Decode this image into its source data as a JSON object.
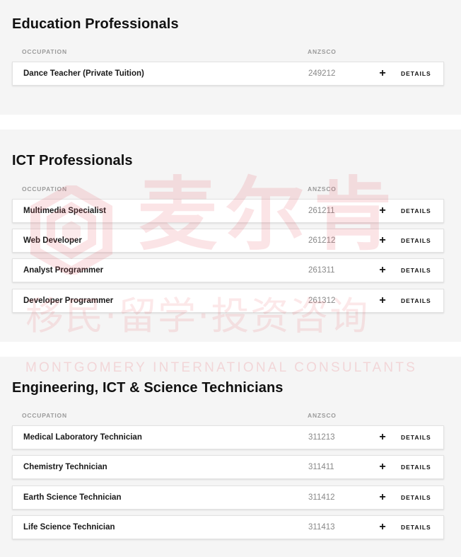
{
  "columns": {
    "occupation": "OCCUPATION",
    "anzsco": "ANZSCO"
  },
  "details_label": "DETAILS",
  "sections": [
    {
      "title": "Education Professionals",
      "rows": [
        {
          "occupation": "Dance Teacher (Private Tuition)",
          "anzsco": "249212"
        }
      ]
    },
    {
      "title": "ICT Professionals",
      "rows": [
        {
          "occupation": "Multimedia Specialist",
          "anzsco": "261211"
        },
        {
          "occupation": "Web Developer",
          "anzsco": "261212"
        },
        {
          "occupation": "Analyst Programmer",
          "anzsco": "261311"
        },
        {
          "occupation": "Developer Programmer",
          "anzsco": "261312"
        }
      ]
    },
    {
      "title": "Engineering, ICT & Science Technicians",
      "rows": [
        {
          "occupation": "Medical Laboratory Technician",
          "anzsco": "311213"
        },
        {
          "occupation": "Chemistry Technician",
          "anzsco": "311411"
        },
        {
          "occupation": "Earth Science Technician",
          "anzsco": "311412"
        },
        {
          "occupation": "Life Science Technician",
          "anzsco": "311413"
        }
      ]
    }
  ],
  "icons": {
    "expand": "plus-icon",
    "watermark_logo": "hexagon-logo-icon"
  },
  "watermark": {
    "brand": "麦尔肯",
    "tagline": "移民·留学·投资咨询",
    "english": "MONTGOMERY INTERNATIONAL CONSULTANTS",
    "color": "#e85a64"
  },
  "colors": {
    "section_bg": "#f5f5f5",
    "row_bg": "#ffffff",
    "header_text": "#9a9a9a"
  }
}
